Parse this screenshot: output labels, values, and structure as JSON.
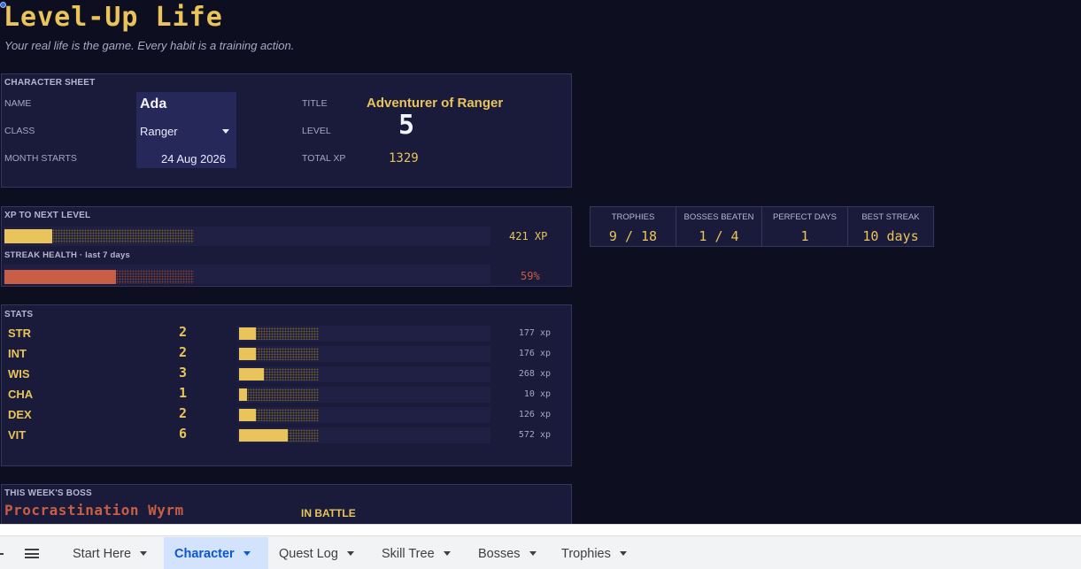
{
  "header": {
    "title": "Level-Up Life",
    "subtitle": "Your real life is the game. Every habit is a training action."
  },
  "character_sheet": {
    "label": "CHARACTER SHEET",
    "name_label": "NAME",
    "name": "Ada",
    "class_label": "CLASS",
    "class": "Ranger",
    "month_label": "MONTH STARTS",
    "month_starts": "24 Aug 2026",
    "title_label": "TITLE",
    "title": "Adventurer  of Ranger",
    "level_label": "LEVEL",
    "level": "5",
    "total_xp_label": "TOTAL XP",
    "total_xp": "1329"
  },
  "progress": {
    "xp_label": "XP TO NEXT LEVEL",
    "xp_value": "421 XP",
    "xp_fraction": 0.25,
    "streak_label": "STREAK HEALTH · last 7 days",
    "streak_value": "59%",
    "streak_fraction": 0.59
  },
  "summary": [
    {
      "label": "TROPHIES",
      "value": "9 / 18"
    },
    {
      "label": "BOSSES BEATEN",
      "value": "1 / 4"
    },
    {
      "label": "PERFECT DAYS",
      "value": "1"
    },
    {
      "label": "BEST STREAK",
      "value": "10 days"
    }
  ],
  "stats": {
    "label": "STATS",
    "rows": [
      {
        "name": "STR",
        "level": "2",
        "xp": "177 xp",
        "fraction": 0.21
      },
      {
        "name": "INT",
        "level": "2",
        "xp": "176 xp",
        "fraction": 0.21
      },
      {
        "name": "WIS",
        "level": "3",
        "xp": "268 xp",
        "fraction": 0.31
      },
      {
        "name": "CHA",
        "level": "1",
        "xp": "10 xp",
        "fraction": 0.1
      },
      {
        "name": "DEX",
        "level": "2",
        "xp": "126 xp",
        "fraction": 0.21
      },
      {
        "name": "VIT",
        "level": "6",
        "xp": "572 xp",
        "fraction": 0.61
      }
    ]
  },
  "boss": {
    "label": "THIS WEEK'S BOSS",
    "name": "Procrastination Wyrm",
    "status": "IN BATTLE"
  },
  "tabs": [
    {
      "label": "Start Here",
      "active": false
    },
    {
      "label": "Character",
      "active": true
    },
    {
      "label": "Quest Log",
      "active": false
    },
    {
      "label": "Skill Tree",
      "active": false
    },
    {
      "label": "Bosses",
      "active": false
    },
    {
      "label": "Trophies",
      "active": false
    }
  ],
  "colors": {
    "background": "#0d0e1f",
    "panel": "#1a1b3a",
    "gold": "#e8c45a",
    "red": "#c75e45",
    "active_tab": "#d3e3fd"
  }
}
